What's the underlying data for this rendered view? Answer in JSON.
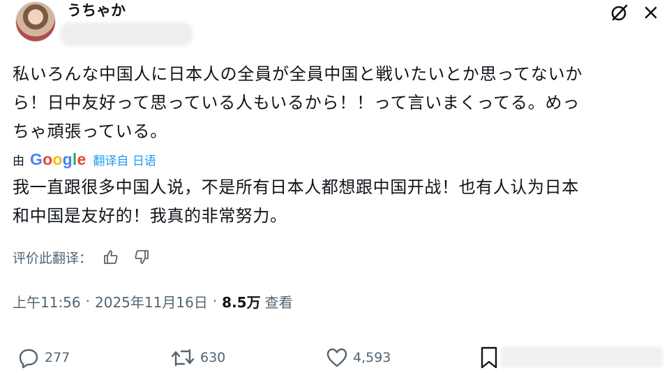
{
  "author": {
    "display_name": "うちゃか",
    "handle": ""
  },
  "post": {
    "text": "私いろんな中国人に日本人の全員が全員中国と戦いたいとか思ってないか\nら！日中友好って思っている人もいるから！！って言いまくってる。めっ\nちゃ頑張っている。",
    "translation_prefix": "由",
    "translation_provider": "Google",
    "translated_from": "翻译自 日语",
    "translated_text": "我一直跟很多中国人说，不是所有日本人都想跟中国开战！也有人认为日本\n和中国是友好的！我真的非常努力。",
    "rate_translation_label": "评价此翻译：",
    "time": "上午11:56",
    "date": "2025年11月16日",
    "views_count": "8.5万",
    "views_label": "查看"
  },
  "actions": {
    "replies": "277",
    "reposts": "630",
    "likes": "4,593"
  },
  "colors": {
    "text": "#0f1419",
    "secondary": "#536471",
    "link": "#1d9bf0"
  },
  "icons": [
    "grok-icon",
    "close-icon",
    "thumbs-up-icon",
    "thumbs-down-icon",
    "reply-icon",
    "repost-icon",
    "like-icon",
    "bookmark-icon"
  ]
}
